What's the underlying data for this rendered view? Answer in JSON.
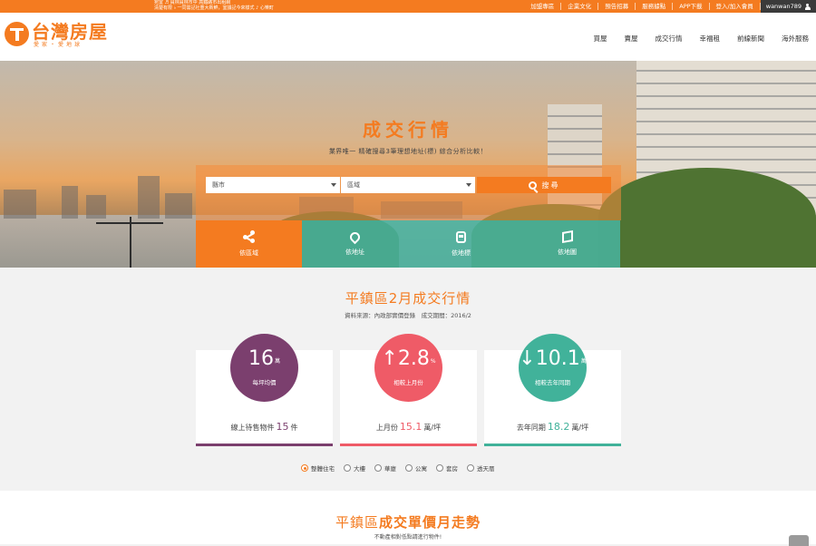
{
  "topbar": {
    "marquee_lines": [
      "宛宜 ♬ 員林員林市中 高鐵路市出租網",
      "清楚有限 ♭ 一同需記社重大新鮮，室議記今來樣式 ♪ 心樂町"
    ],
    "links": [
      "加盟專區",
      "企業文化",
      "預告招募",
      "服務據點",
      "APP下載",
      "登入/加入會員"
    ],
    "username": "wanwan789"
  },
  "header": {
    "logo_text": "台灣房屋",
    "logo_slogan": "愛家・愛地球",
    "nav": [
      "買屋",
      "賣屋",
      "成交行情",
      "幸福租",
      "前線新聞",
      "海外服務"
    ]
  },
  "hero": {
    "title": "成交行情",
    "subtitle": "業界唯一 精確搜尋3筆理想地址(標) 綜合分析比較！",
    "county_placeholder": "縣市",
    "district_placeholder": "區域",
    "search_label": "搜尋",
    "tabs": [
      {
        "label": "依區域",
        "icon": "share-icon"
      },
      {
        "label": "依地址",
        "icon": "location-pin-icon"
      },
      {
        "label": "依地標",
        "icon": "train-icon"
      },
      {
        "label": "依地圖",
        "icon": "map-icon"
      }
    ]
  },
  "stats": {
    "title": "平鎮區2月成交行情",
    "meta": "資料來源：內政部實價登錄　成交期間：2016/2",
    "cards": [
      {
        "value": "16",
        "unit": "萬",
        "caption": "每坪均價",
        "footer_pre": "線上待售物件",
        "footer_hl": "15",
        "footer_post": "件",
        "color": "#7b3f6e"
      },
      {
        "value": "↑2.8",
        "unit": "%",
        "caption": "相較上月份",
        "footer_pre": "上月份",
        "footer_hl": "15.1",
        "footer_post": "萬/坪",
        "color": "#ef5b67"
      },
      {
        "value": "↓10.1",
        "unit": "萬",
        "caption": "相較去年同期",
        "footer_pre": "去年同期",
        "footer_hl": "18.2",
        "footer_post": "萬/坪",
        "color": "#41b29a"
      }
    ],
    "property_types": [
      "整體住宅",
      "大樓",
      "華廈",
      "公寓",
      "套房",
      "透天厝"
    ],
    "selected_type": "整體住宅"
  },
  "trend": {
    "title_prefix": "平鎮區",
    "title_suffix": "成交單價月走勢",
    "subtitle": "不動產相對低點請進行物件!"
  },
  "colors": {
    "brand": "#f47b20",
    "teal": "#48b4a0"
  }
}
